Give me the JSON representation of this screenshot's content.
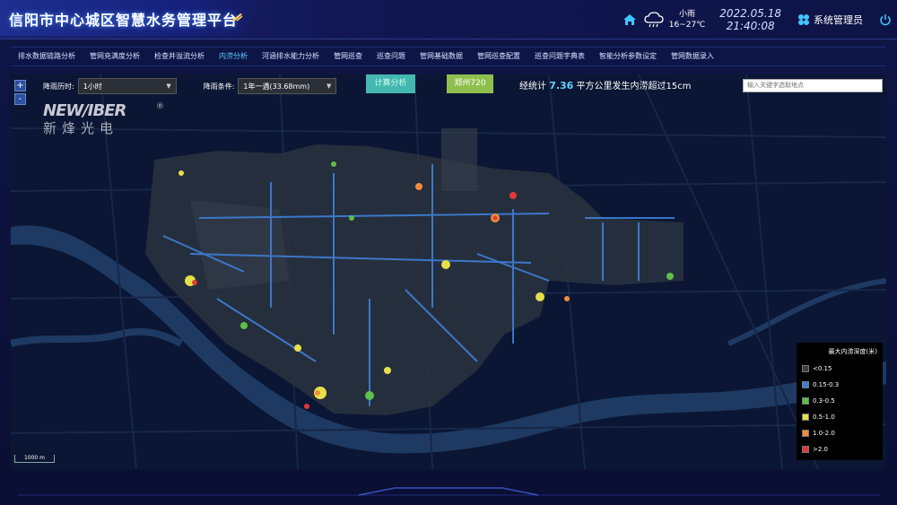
{
  "header": {
    "title": "信阳市中心城区智慧水务管理平台",
    "weather": {
      "condition": "小雨",
      "temp": "16~27℃"
    },
    "date": "2022.05.18",
    "time": "21:40:08",
    "user": "系统管理员"
  },
  "nav": {
    "items": [
      "排水数据链路分析",
      "管网充满度分析",
      "检查井溢流分析",
      "内涝分析",
      "河涵排水能力分析",
      "管网巡查",
      "巡查问题",
      "管网基础数据",
      "管网巡查配置",
      "巡查问题字典表",
      "智能分析参数设定",
      "管网数据录入"
    ],
    "active_index": 3
  },
  "toolbar": {
    "duration_label": "降雨历时:",
    "duration_value": "1小时",
    "condition_label": "降雨条件:",
    "condition_value": "1年一遇(33.68mm)",
    "calc_button": "计算分析",
    "city_button": "郑州720",
    "stat_prefix": "经统计",
    "stat_value": "7.36",
    "stat_suffix": "平方公里发生内涝超过15cm",
    "search_placeholder": "输入关键字选取地点"
  },
  "map": {
    "zoom_in": "+",
    "zoom_out": "-",
    "scale_label": "1000 m",
    "logo_en": "NEW/IBER",
    "logo_reg": "®",
    "logo_cn": "新烽光电"
  },
  "legend": {
    "title": "最大内涝深度(米)",
    "items": [
      {
        "label": "<0.15",
        "color": "#3a3f46"
      },
      {
        "label": "0.15-0.3",
        "color": "#3f7fd8"
      },
      {
        "label": "0.3-0.5",
        "color": "#5fbf4a"
      },
      {
        "label": "0.5-1.0",
        "color": "#e6e04a"
      },
      {
        "label": "1.0-2.0",
        "color": "#f08c3c"
      },
      {
        "label": ">2.0",
        "color": "#e03a3a"
      }
    ]
  },
  "colors": {
    "accent": "#5cd0ff",
    "calc_button": "#44b7b0",
    "city_button": "#8fc04d"
  }
}
